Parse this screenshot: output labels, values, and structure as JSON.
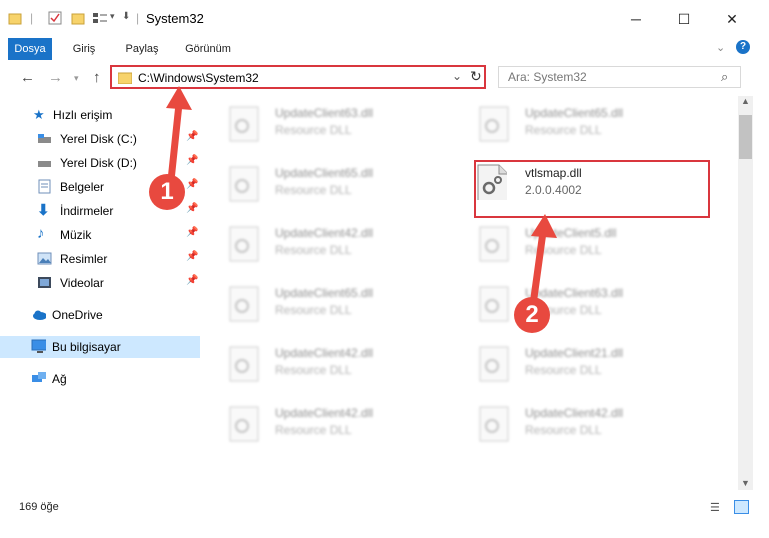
{
  "window": {
    "title": "System32"
  },
  "ribbon": {
    "tabs": [
      "Dosya",
      "Giriş",
      "Paylaş",
      "Görünüm"
    ]
  },
  "address": {
    "path": "C:\\Windows\\System32"
  },
  "search": {
    "placeholder": "Ara: System32"
  },
  "sidebar": {
    "items": [
      {
        "label": "Hızlı erişim",
        "icon": "star-icon",
        "pinned": false
      },
      {
        "label": "Yerel Disk (C:)",
        "icon": "drive-icon",
        "pinned": true
      },
      {
        "label": "Yerel Disk (D:)",
        "icon": "drive-icon",
        "pinned": true
      },
      {
        "label": "Belgeler",
        "icon": "documents-icon",
        "pinned": true
      },
      {
        "label": "İndirmeler",
        "icon": "download-icon",
        "pinned": true
      },
      {
        "label": "Müzik",
        "icon": "music-icon",
        "pinned": true
      },
      {
        "label": "Resimler",
        "icon": "pictures-icon",
        "pinned": true
      },
      {
        "label": "Videolar",
        "icon": "video-icon",
        "pinned": true
      },
      {
        "label": "OneDrive",
        "icon": "cloud-icon",
        "pinned": false
      },
      {
        "label": "Bu bilgisayar",
        "icon": "computer-icon",
        "pinned": false,
        "selected": true
      },
      {
        "label": "Ağ",
        "icon": "network-icon",
        "pinned": false
      }
    ]
  },
  "files": [
    {
      "name": "UpdateClient63.dll",
      "desc": "Resource DLL",
      "blurred": true
    },
    {
      "name": "UpdateClient65.dll",
      "desc": "Resource DLL",
      "blurred": true
    },
    {
      "name": "UpdateClient65.dll",
      "desc": "Resource DLL",
      "blurred": true
    },
    {
      "name": "vtlsmap.dll",
      "desc": "2.0.0.4002",
      "blurred": false
    },
    {
      "name": "UpdateClient42.dll",
      "desc": "Resource DLL",
      "blurred": true
    },
    {
      "name": "UpdateClient5.dll",
      "desc": "Resource DLL",
      "blurred": true
    },
    {
      "name": "UpdateClient65.dll",
      "desc": "Resource DLL",
      "blurred": true
    },
    {
      "name": "UpdateClient63.dll",
      "desc": "Resource DLL",
      "blurred": true
    },
    {
      "name": "UpdateClient42.dll",
      "desc": "Resource DLL",
      "blurred": true
    },
    {
      "name": "UpdateClient21.dll",
      "desc": "Resource DLL",
      "blurred": true
    },
    {
      "name": "UpdateClient42.dll",
      "desc": "Resource DLL",
      "blurred": true
    },
    {
      "name": "UpdateClient42.dll",
      "desc": "Resource DLL",
      "blurred": true
    }
  ],
  "status": {
    "count_text": "169 öğe"
  },
  "annotations": {
    "badge1": "1",
    "badge2": "2"
  },
  "colors": {
    "accent": "#1a73c8",
    "highlight": "#d9363e"
  }
}
